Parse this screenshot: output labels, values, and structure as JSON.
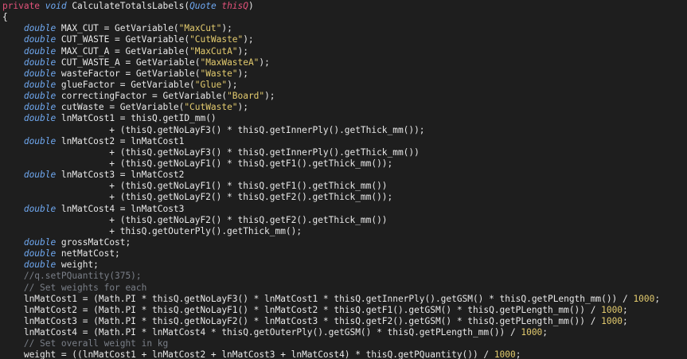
{
  "editor": {
    "colors": {
      "background": "#1e1e1e",
      "text": "#e8e8e8",
      "keyword": "#e2527a",
      "type": "#6fa8f0",
      "string": "#e3cb6e",
      "number": "#e3cb6e",
      "comment": "#7a7f88",
      "param": "#e2527a"
    },
    "lines": [
      [
        [
          "k",
          "private"
        ],
        [
          "t",
          " "
        ],
        [
          "y",
          "void"
        ],
        [
          "t",
          " CalculateTotalsLabels("
        ],
        [
          "y",
          "Quote"
        ],
        [
          "t",
          " "
        ],
        [
          "p",
          "thisQ"
        ],
        [
          "t",
          ")"
        ]
      ],
      [
        [
          "t",
          "{"
        ]
      ],
      [
        [
          "t",
          "    "
        ],
        [
          "y",
          "double"
        ],
        [
          "t",
          " MAX_CUT = GetVariable("
        ],
        [
          "s",
          "\"MaxCut\""
        ],
        [
          "t",
          ");"
        ]
      ],
      [
        [
          "t",
          "    "
        ],
        [
          "y",
          "double"
        ],
        [
          "t",
          " CUT_WASTE = GetVariable("
        ],
        [
          "s",
          "\"CutWaste\""
        ],
        [
          "t",
          ");"
        ]
      ],
      [
        [
          "t",
          "    "
        ],
        [
          "y",
          "double"
        ],
        [
          "t",
          " MAX_CUT_A = GetVariable("
        ],
        [
          "s",
          "\"MaxCutA\""
        ],
        [
          "t",
          ");"
        ]
      ],
      [
        [
          "t",
          "    "
        ],
        [
          "y",
          "double"
        ],
        [
          "t",
          " CUT_WASTE_A = GetVariable("
        ],
        [
          "s",
          "\"MaxWasteA\""
        ],
        [
          "t",
          ");"
        ]
      ],
      [
        [
          "t",
          "    "
        ],
        [
          "y",
          "double"
        ],
        [
          "t",
          " wasteFactor = GetVariable("
        ],
        [
          "s",
          "\"Waste\""
        ],
        [
          "t",
          ");"
        ]
      ],
      [
        [
          "t",
          "    "
        ],
        [
          "y",
          "double"
        ],
        [
          "t",
          " glueFactor = GetVariable("
        ],
        [
          "s",
          "\"Glue\""
        ],
        [
          "t",
          ");"
        ]
      ],
      [
        [
          "t",
          "    "
        ],
        [
          "y",
          "double"
        ],
        [
          "t",
          " correctingFactor = GetVariable("
        ],
        [
          "s",
          "\"Board\""
        ],
        [
          "t",
          ");"
        ]
      ],
      [
        [
          "t",
          "    "
        ],
        [
          "y",
          "double"
        ],
        [
          "t",
          " cutWaste = GetVariable("
        ],
        [
          "s",
          "\"CutWaste\""
        ],
        [
          "t",
          ");"
        ]
      ],
      [
        [
          "t",
          "    "
        ],
        [
          "y",
          "double"
        ],
        [
          "t",
          " lnMatCost1 = thisQ.getID_mm()"
        ]
      ],
      [
        [
          "t",
          "                    + (thisQ.getNoLayF3() * thisQ.getInnerPly().getThick_mm());"
        ]
      ],
      [
        [
          "t",
          "    "
        ],
        [
          "y",
          "double"
        ],
        [
          "t",
          " lnMatCost2 = lnMatCost1"
        ]
      ],
      [
        [
          "t",
          "                    + (thisQ.getNoLayF3() * thisQ.getInnerPly().getThick_mm())"
        ]
      ],
      [
        [
          "t",
          "                    + (thisQ.getNoLayF1() * thisQ.getF1().getThick_mm());"
        ]
      ],
      [
        [
          "t",
          "    "
        ],
        [
          "y",
          "double"
        ],
        [
          "t",
          " lnMatCost3 = lnMatCost2"
        ]
      ],
      [
        [
          "t",
          "                    + (thisQ.getNoLayF1() * thisQ.getF1().getThick_mm())"
        ]
      ],
      [
        [
          "t",
          "                    + (thisQ.getNoLayF2() * thisQ.getF2().getThick_mm());"
        ]
      ],
      [
        [
          "t",
          "    "
        ],
        [
          "y",
          "double"
        ],
        [
          "t",
          " lnMatCost4 = lnMatCost3"
        ]
      ],
      [
        [
          "t",
          "                    + (thisQ.getNoLayF2() * thisQ.getF2().getThick_mm())"
        ]
      ],
      [
        [
          "t",
          "                    + thisQ.getOuterPly().getThick_mm();"
        ]
      ],
      [
        [
          "t",
          "    "
        ],
        [
          "y",
          "double"
        ],
        [
          "t",
          " grossMatCost;"
        ]
      ],
      [
        [
          "t",
          "    "
        ],
        [
          "y",
          "double"
        ],
        [
          "t",
          " netMatCost;"
        ]
      ],
      [
        [
          "t",
          "    "
        ],
        [
          "y",
          "double"
        ],
        [
          "t",
          " weight;"
        ]
      ],
      [
        [
          "t",
          "    "
        ],
        [
          "c",
          "//q.setPQuantity(375);"
        ]
      ],
      [
        [
          "t",
          "    "
        ],
        [
          "c",
          "// Set weights for each"
        ]
      ],
      [
        [
          "t",
          "    lnMatCost1 = (Math.PI * thisQ.getNoLayF3() * lnMatCost1 * thisQ.getInnerPly().getGSM() * thisQ.getPLength_mm()) / "
        ],
        [
          "n",
          "1000"
        ],
        [
          "t",
          ";"
        ]
      ],
      [
        [
          "t",
          "    lnMatCost2 = (Math.PI * thisQ.getNoLayF1() * lnMatCost2 * thisQ.getF1().getGSM() * thisQ.getPLength_mm()) / "
        ],
        [
          "n",
          "1000"
        ],
        [
          "t",
          ";"
        ]
      ],
      [
        [
          "t",
          "    lnMatCost3 = (Math.PI * thisQ.getNoLayF2() * lnMatCost3 * thisQ.getF2().getGSM() * thisQ.getPLength_mm()) / "
        ],
        [
          "n",
          "1000"
        ],
        [
          "t",
          ";"
        ]
      ],
      [
        [
          "t",
          "    lnMatCost4 = (Math.PI * lnMatCost4 * thisQ.getOuterPly().getGSM() * thisQ.getPLength_mm()) / "
        ],
        [
          "n",
          "1000"
        ],
        [
          "t",
          ";"
        ]
      ],
      [
        [
          "t",
          "    "
        ],
        [
          "c",
          "// Set overall weight in kg"
        ]
      ],
      [
        [
          "t",
          "    weight = ((lnMatCost1 + lnMatCost2 + lnMatCost3 + lnMatCost4) * thisQ.getPQuantity()) / "
        ],
        [
          "n",
          "1000"
        ],
        [
          "t",
          ";"
        ]
      ]
    ]
  }
}
